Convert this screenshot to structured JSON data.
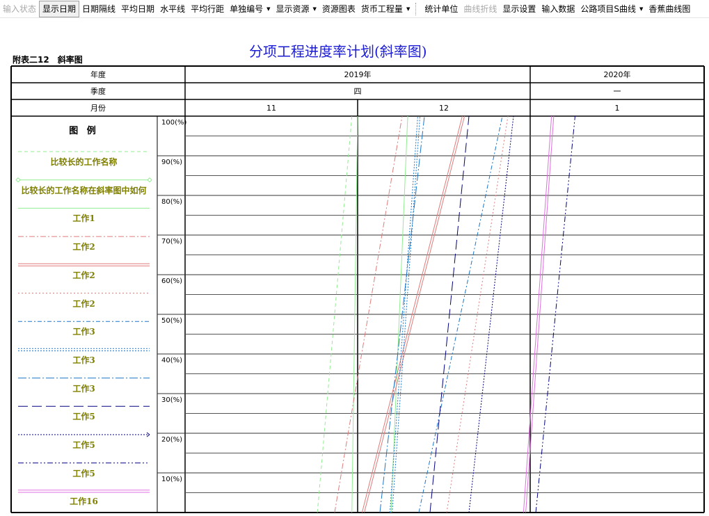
{
  "toolbar": {
    "items": [
      {
        "label": "输入状态",
        "disabled": true
      },
      {
        "label": "显示日期",
        "active": true
      },
      {
        "label": "日期隔线"
      },
      {
        "label": "平均日期"
      },
      {
        "label": "水平线"
      },
      {
        "label": "平均行距"
      },
      {
        "label": "单独编号",
        "dropdown": true
      },
      {
        "label": "显示资源",
        "dropdown": true
      },
      {
        "label": "资源图表"
      },
      {
        "label": "货币工程量",
        "dropdown": true
      },
      {
        "label": "统计单位"
      },
      {
        "label": "曲线折线",
        "disabled": true
      },
      {
        "label": "显示设置"
      },
      {
        "label": "输入数据"
      },
      {
        "label": "公路项目S曲线",
        "dropdown": true
      },
      {
        "label": "香蕉曲线图"
      }
    ]
  },
  "chart_title": "分项工程进度率计划(斜率图)",
  "table_label": "附表二12　斜率图",
  "header": {
    "row_labels": {
      "year": "年度",
      "quarter": "季度",
      "month": "月份"
    },
    "years": [
      "2019年",
      "2020年"
    ],
    "quarters": [
      "四",
      "一"
    ],
    "months": [
      "11",
      "12",
      "1"
    ]
  },
  "legend": {
    "title": "图 例",
    "items": [
      {
        "label": "比较长的工作名称",
        "color": "#90ee90",
        "style": "dash"
      },
      {
        "label": "比较长的工作名称在斜率图中如何",
        "color": "#90ee90",
        "style": "diamond-ends"
      },
      {
        "label": "工作1",
        "color": "#90ee90",
        "style": "solid"
      },
      {
        "label": "工作2",
        "color": "#e07b7b",
        "style": "dashdot"
      },
      {
        "label": "工作2",
        "color": "#e07b7b",
        "style": "double"
      },
      {
        "label": "工作2",
        "color": "#e07b7b",
        "style": "dot"
      },
      {
        "label": "工作3",
        "color": "#1a75c9",
        "style": "dashdot-short"
      },
      {
        "label": "工作3",
        "color": "#1a75c9",
        "style": "double-dot"
      },
      {
        "label": "工作3",
        "color": "#1a75c9",
        "style": "dashdot-long"
      },
      {
        "label": "工作5",
        "color": "#000080",
        "style": "long-dash"
      },
      {
        "label": "工作5",
        "color": "#000080",
        "style": "dot-arrow"
      },
      {
        "label": "工作5",
        "color": "#000080",
        "style": "dashdotdot"
      },
      {
        "label": "工作16",
        "color": "#e070e0",
        "style": "double"
      }
    ]
  },
  "chart_data": {
    "type": "line",
    "title": "分项工程进度率计划(斜率图)",
    "ylabel": "",
    "y_ticks": [
      "100(%)",
      "90(%)",
      "80(%)",
      "70(%)",
      "60(%)",
      "50(%)",
      "40(%)",
      "30(%)",
      "20(%)",
      "10(%)"
    ],
    "ylim": [
      0,
      100
    ],
    "x_months": [
      "2019-11",
      "2019-12",
      "2020-01"
    ],
    "xlim": [
      "2019-11-01",
      "2020-01-31"
    ],
    "series": [
      {
        "name": "比较长的工作名称",
        "color": "#90ee90",
        "style": "dash",
        "x_start": "2019-11-24",
        "x_end": "2019-11-30"
      },
      {
        "name": "比较长的工作名称在斜率图中如何",
        "color": "#90ee90",
        "style": "solid",
        "x_start": "2019-11-30",
        "x_end": "2019-12-01"
      },
      {
        "name": "工作1",
        "color": "#90ee90",
        "style": "solid",
        "x_start": "2019-12-07",
        "x_end": "2019-12-10"
      },
      {
        "name": "工作2",
        "color": "#e07b7b",
        "style": "dashdot",
        "x_start": "2019-11-27",
        "x_end": "2019-12-09"
      },
      {
        "name": "工作2",
        "color": "#e07b7b",
        "style": "double",
        "x_start": "2019-12-02",
        "x_end": "2019-12-20"
      },
      {
        "name": "工作2",
        "color": "#e07b7b",
        "style": "dot",
        "x_start": "2019-12-17",
        "x_end": "2019-12-28"
      },
      {
        "name": "工作3",
        "color": "#1a75c9",
        "style": "dashdot-short",
        "x_start": "2019-12-12",
        "x_end": "2019-12-27"
      },
      {
        "name": "工作3",
        "color": "#1a75c9",
        "style": "double-dot",
        "x_start": "2019-12-07",
        "x_end": "2019-12-12"
      },
      {
        "name": "工作3",
        "color": "#1a75c9",
        "style": "dashdot-long",
        "x_start": "2019-12-05",
        "x_end": "2019-12-13"
      },
      {
        "name": "工作5",
        "color": "#000080",
        "style": "long-dash",
        "x_start": "2019-12-14",
        "x_end": "2019-12-21"
      },
      {
        "name": "工作5",
        "color": "#000080",
        "style": "dot-arrow",
        "x_start": "2019-12-21",
        "x_end": "2019-12-29"
      },
      {
        "name": "工作5",
        "color": "#000080",
        "style": "dashdotdot",
        "x_start": "2020-01-02",
        "x_end": "2020-01-09"
      },
      {
        "name": "工作16",
        "color": "#e070e0",
        "style": "double",
        "x_start": "2019-12-31",
        "x_end": "2020-01-05"
      }
    ]
  }
}
